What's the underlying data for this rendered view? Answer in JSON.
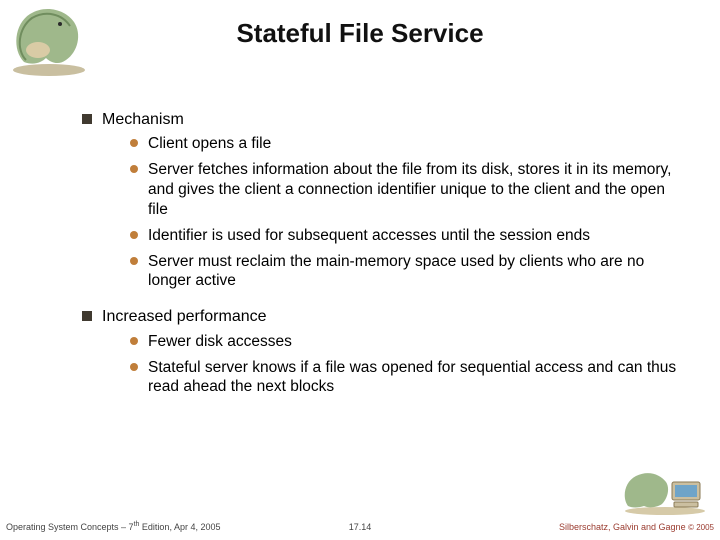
{
  "title": "Stateful File Service",
  "bullets": [
    {
      "text": "Mechanism",
      "children": [
        {
          "text": "Client opens a file"
        },
        {
          "text": "Server fetches information about the file from its disk, stores it in its memory, and gives the client a connection identifier unique to the client and the open file"
        },
        {
          "text": "Identifier is used for subsequent accesses until the session ends"
        },
        {
          "text": "Server must reclaim the main-memory space used by clients who are no longer active"
        }
      ]
    },
    {
      "text": "Increased performance",
      "children": [
        {
          "text": "Fewer disk accesses"
        },
        {
          "text": "Stateful server knows if a file was opened for sequential access and can thus read ahead the next blocks"
        }
      ]
    }
  ],
  "footer": {
    "left_prefix": "Operating System Concepts – 7",
    "left_suffix": " Edition, Apr 4, 2005",
    "left_super": "th",
    "center": "17.14",
    "right_main": "Silberschatz, Galvin and Gagne ",
    "right_copy": "© 2005"
  },
  "icons": {
    "top_mascot": "dinosaur-mascot-icon",
    "bottom_mascot": "dinosaur-computer-icon"
  }
}
